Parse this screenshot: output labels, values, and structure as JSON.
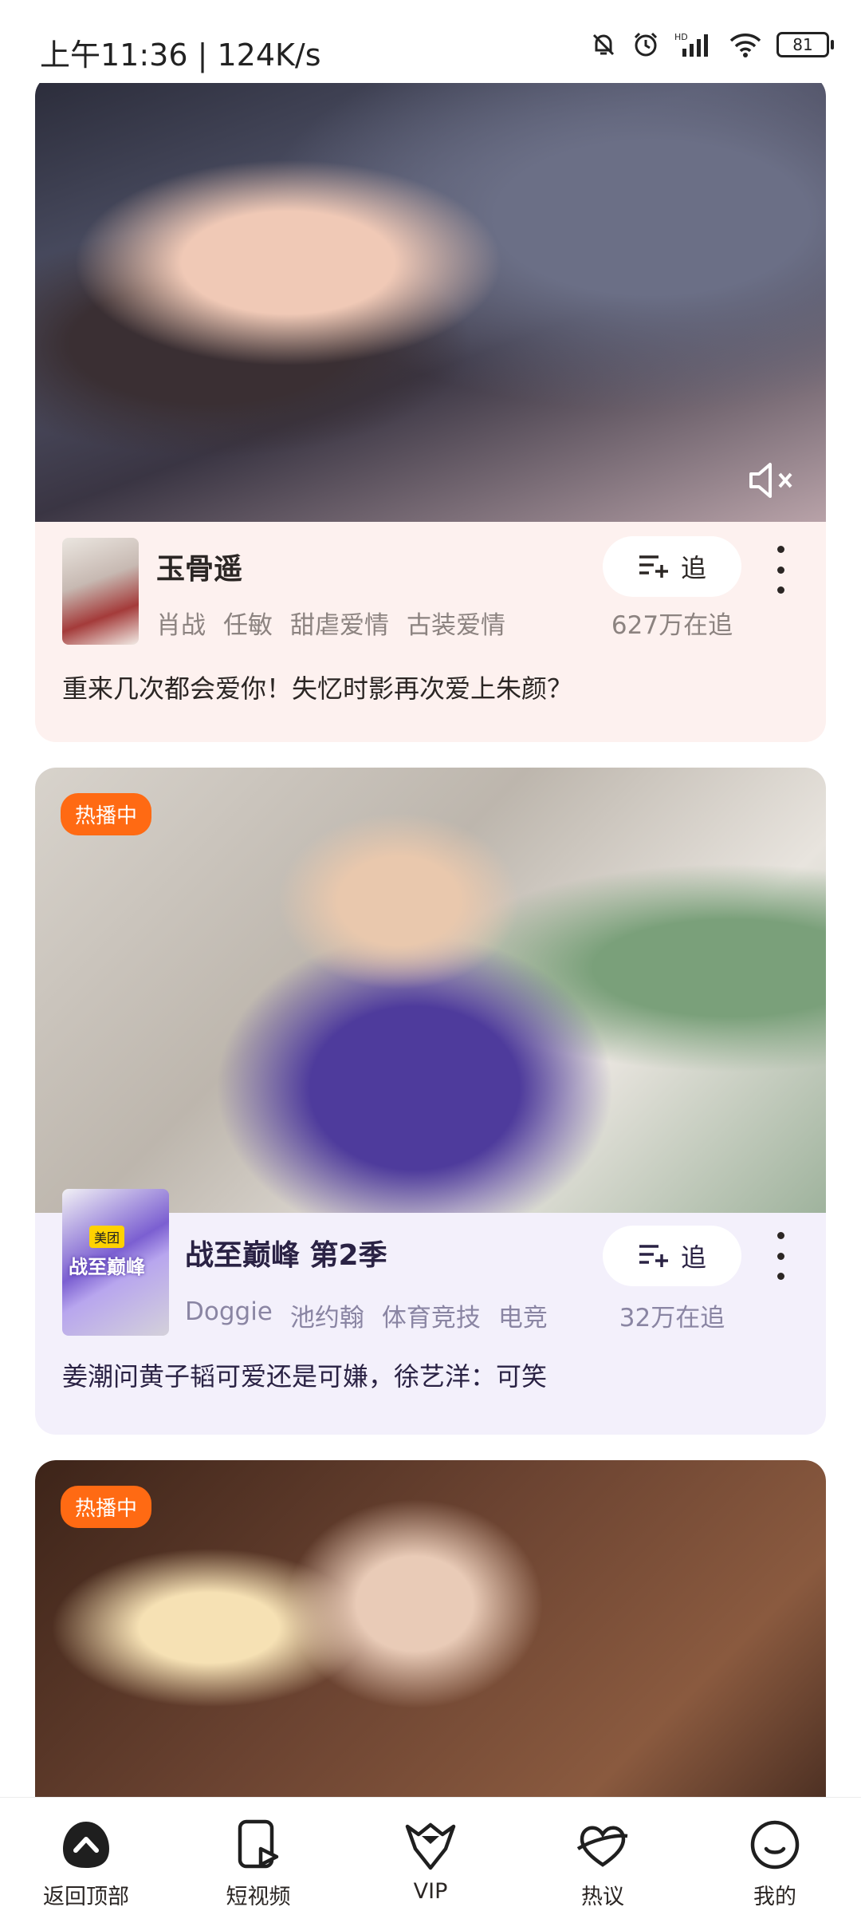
{
  "status_bar": {
    "time": "上午11:36 | 124K/s",
    "battery": "81",
    "icons": [
      "bell-muted-icon",
      "alarm-icon",
      "hd-signal-icon",
      "wifi-icon",
      "battery-icon"
    ]
  },
  "cards": [
    {
      "title": "玉骨遥",
      "tags": [
        "肖战",
        "任敏",
        "甜虐爱情",
        "古装爱情"
      ],
      "follow_label": "追",
      "follow_count": "627万在追",
      "description": "重来几次都会爱你！失忆时影再次爱上朱颜？",
      "mute_icon": "mute-icon",
      "accent": "#fdf1ef"
    },
    {
      "badge": "热播中",
      "title": "战至巅峰 第2季",
      "tags": [
        "Doggie",
        "池约翰",
        "体育竞技",
        "电竞"
      ],
      "follow_label": "追",
      "follow_count": "32万在追",
      "description": "姜潮问黄子韬可爱还是可嫌，徐艺洋：可笑",
      "poster_tag": "美团",
      "poster_text": "战至巅峰",
      "accent": "#f3f0fb"
    },
    {
      "badge": "热播中"
    }
  ],
  "bottom_nav": [
    {
      "label": "返回顶部",
      "icon": "back-to-top-icon"
    },
    {
      "label": "短视频",
      "icon": "short-video-icon"
    },
    {
      "label": "VIP",
      "icon": "vip-crown-icon"
    },
    {
      "label": "热议",
      "icon": "hot-discussion-icon"
    },
    {
      "label": "我的",
      "icon": "profile-smile-icon"
    }
  ],
  "colors": {
    "badge": "#ff6a13",
    "text_dark": "#2b2624",
    "text_muted": "#8c8380"
  }
}
